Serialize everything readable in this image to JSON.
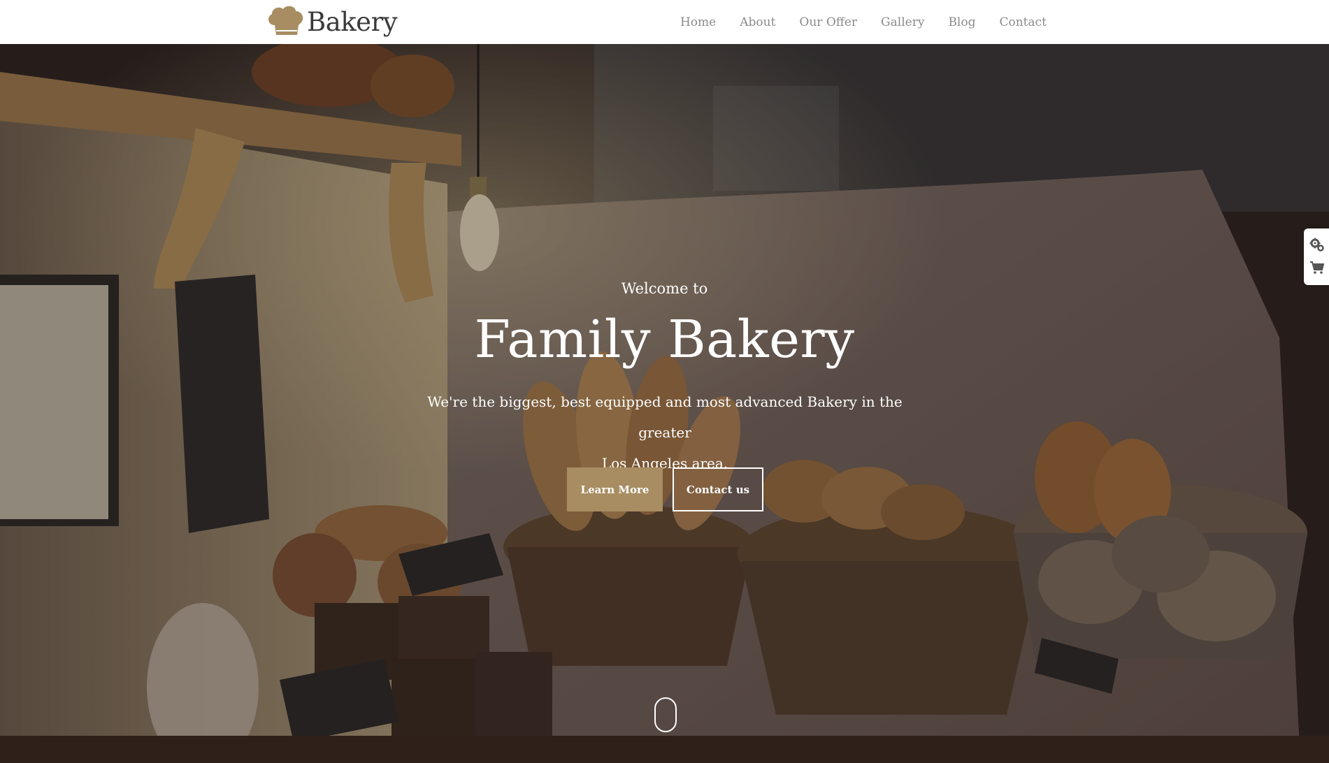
{
  "header": {
    "logo_text": "Bakery",
    "nav": [
      "Home",
      "About",
      "Our Offer",
      "Gallery",
      "Blog",
      "Contact"
    ]
  },
  "hero": {
    "welcome": "Welcome to",
    "title": "Family Bakery",
    "description_line1": "We're the biggest, best equipped and most advanced Bakery in the greater",
    "description_line2": "Los Angeles area.",
    "learn_more": "Learn More",
    "contact_us": "Contact us"
  },
  "icons": {
    "logo": "chef-hat-icon",
    "settings": "gears-icon",
    "cart": "shopping-cart-icon",
    "scroll": "mouse-scroll-icon"
  },
  "colors": {
    "accent": "#a88d62",
    "nav_text": "#8a8a8a",
    "header_bg": "#ffffff"
  }
}
